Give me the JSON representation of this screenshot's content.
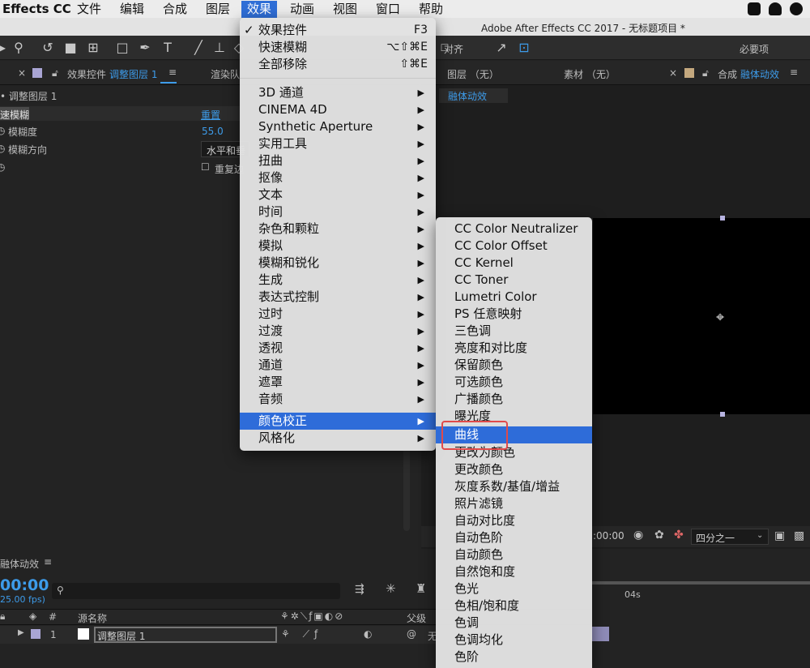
{
  "menubar": {
    "app_name": "Effects CC",
    "items": [
      "文件",
      "编辑",
      "合成",
      "图层",
      "效果",
      "动画",
      "视图",
      "窗口",
      "帮助"
    ],
    "active": "效果"
  },
  "window_title": "Adobe After Effects CC 2017 - 无标题项目 *",
  "toolbar": {
    "align_label": "对齐",
    "workspace_label": "必要项"
  },
  "effect_controls": {
    "tab_label": "效果控件",
    "tab_layer": "调整图层 1",
    "menu_icon": "hamburger-icon",
    "other_tab": "渲染队",
    "layer_row": "• 调整图层 1",
    "effect_name": "速模糊",
    "reset_label": "重置",
    "params": [
      {
        "name": "模糊度",
        "value": "55.0"
      },
      {
        "name": "模糊方向",
        "value": "水平和垂"
      }
    ],
    "repeat_label": "重复边"
  },
  "viewer": {
    "layer_tab": "图层 （无）",
    "footage_tab": "素材 （无）",
    "comp_tab_label": "合成",
    "comp_tab_name": "融体动效",
    "comp_chip": "融体动效",
    "timecode": ":00:00",
    "resolution": "四分之一"
  },
  "timeline": {
    "comp_name": "融体动效",
    "timecode": "00:00",
    "fps": "25.00 fps)",
    "search_placeholder": "",
    "col_hash": "#",
    "col_source": "源名称",
    "col_parent": "父级",
    "ruler_mark": "04s",
    "layer": {
      "index": "1",
      "name": "调整图层 1",
      "parent_prefix": "无"
    }
  },
  "effect_menu": {
    "items": [
      {
        "label": "效果控件",
        "check": "✓",
        "shortcut": "F3"
      },
      {
        "label": "快速模糊",
        "shortcut": "⌥⇧⌘E"
      },
      {
        "label": "全部移除",
        "shortcut": "⇧⌘E"
      },
      {
        "label": "3D 通道",
        "submenu": true
      },
      {
        "label": "CINEMA 4D",
        "submenu": true
      },
      {
        "label": "Synthetic Aperture",
        "submenu": true
      },
      {
        "label": "实用工具",
        "submenu": true
      },
      {
        "label": "扭曲",
        "submenu": true
      },
      {
        "label": "抠像",
        "submenu": true
      },
      {
        "label": "文本",
        "submenu": true
      },
      {
        "label": "时间",
        "submenu": true
      },
      {
        "label": "杂色和颗粒",
        "submenu": true
      },
      {
        "label": "模拟",
        "submenu": true
      },
      {
        "label": "模糊和锐化",
        "submenu": true
      },
      {
        "label": "生成",
        "submenu": true
      },
      {
        "label": "表达式控制",
        "submenu": true
      },
      {
        "label": "过时",
        "submenu": true
      },
      {
        "label": "过渡",
        "submenu": true
      },
      {
        "label": "透视",
        "submenu": true
      },
      {
        "label": "通道",
        "submenu": true
      },
      {
        "label": "遮罩",
        "submenu": true
      },
      {
        "label": "音频",
        "submenu": true
      },
      {
        "label": "颜色校正",
        "submenu": true,
        "highlighted": true
      },
      {
        "label": "风格化",
        "submenu": true
      }
    ],
    "arrow": "▶"
  },
  "color_submenu": {
    "items": [
      "CC Color Neutralizer",
      "CC Color Offset",
      "CC Kernel",
      "CC Toner",
      "Lumetri Color",
      "PS 任意映射",
      "三色调",
      "亮度和对比度",
      "保留颜色",
      "可选颜色",
      "广播颜色",
      "曝光度",
      "曲线",
      "更改为颜色",
      "更改颜色",
      "灰度系数/基值/增益",
      "照片滤镜",
      "自动对比度",
      "自动色阶",
      "自动颜色",
      "自然饱和度",
      "色光",
      "色相/饱和度",
      "色调",
      "色调均化",
      "色阶"
    ],
    "highlighted": "曲线",
    "highlight_color": "#2e6cd9",
    "annotation_color": "#e04a4a"
  }
}
